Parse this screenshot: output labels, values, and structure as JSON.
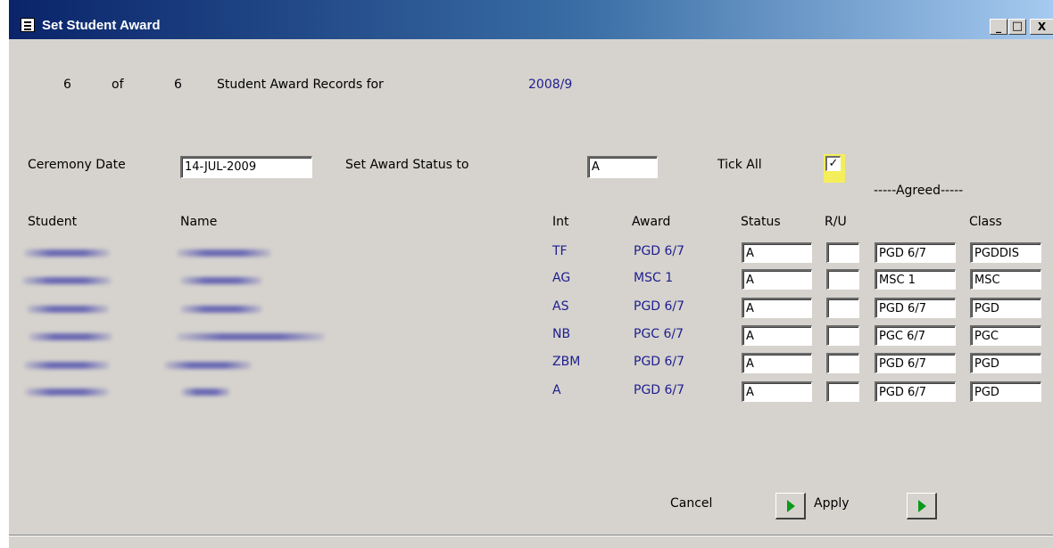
{
  "window": {
    "title": "Set Student Award",
    "controls": {
      "minimize": "_",
      "maximize": "□",
      "close": "X"
    }
  },
  "header": {
    "current": "6",
    "of": "of",
    "total": "6",
    "records_label": "Student Award Records for",
    "year": "2008/9"
  },
  "form": {
    "ceremony_label": "Ceremony Date",
    "ceremony_value": "14-JUL-2009",
    "status_label": "Set Award Status to",
    "status_value": "A",
    "tick_all_label": "Tick All",
    "tick_all_checked": true,
    "tick_mark": "✓"
  },
  "table": {
    "agreed_header": "-----Agreed-----",
    "columns": {
      "student": "Student",
      "name": "Name",
      "int": "Int",
      "award": "Award",
      "status": "Status",
      "ru": "R/U",
      "class": "Class"
    },
    "rows": [
      {
        "int": "TF",
        "award": "PGD 6/7",
        "status": "A",
        "ru": "",
        "agreed_award": "PGD 6/7",
        "agreed_class": "PGDDIS"
      },
      {
        "int": "AG",
        "award": "MSC 1",
        "status": "A",
        "ru": "",
        "agreed_award": "MSC 1",
        "agreed_class": "MSC"
      },
      {
        "int": "AS",
        "award": "PGD 6/7",
        "status": "A",
        "ru": "",
        "agreed_award": "PGD 6/7",
        "agreed_class": "PGD"
      },
      {
        "int": "NB",
        "award": "PGC 6/7",
        "status": "A",
        "ru": "",
        "agreed_award": "PGC 6/7",
        "agreed_class": "PGC"
      },
      {
        "int": "ZBM",
        "award": "PGD 6/7",
        "status": "A",
        "ru": "",
        "agreed_award": "PGD 6/7",
        "agreed_class": "PGD"
      },
      {
        "int": "A",
        "award": "PGD 6/7",
        "status": "A",
        "ru": "",
        "agreed_award": "PGD 6/7",
        "agreed_class": "PGD"
      }
    ]
  },
  "footer": {
    "cancel_label": "Cancel",
    "apply_label": "Apply"
  },
  "colors": {
    "title_bar": "#0a246a",
    "window_bg": "#d6d3ce",
    "value_text": "#1d1d8f",
    "tick_highlight": "#f5ee5c",
    "arrow_green": "#0a9a1a"
  },
  "icons": {
    "title": "form-document-icon",
    "arrow": "play-arrow-icon"
  }
}
